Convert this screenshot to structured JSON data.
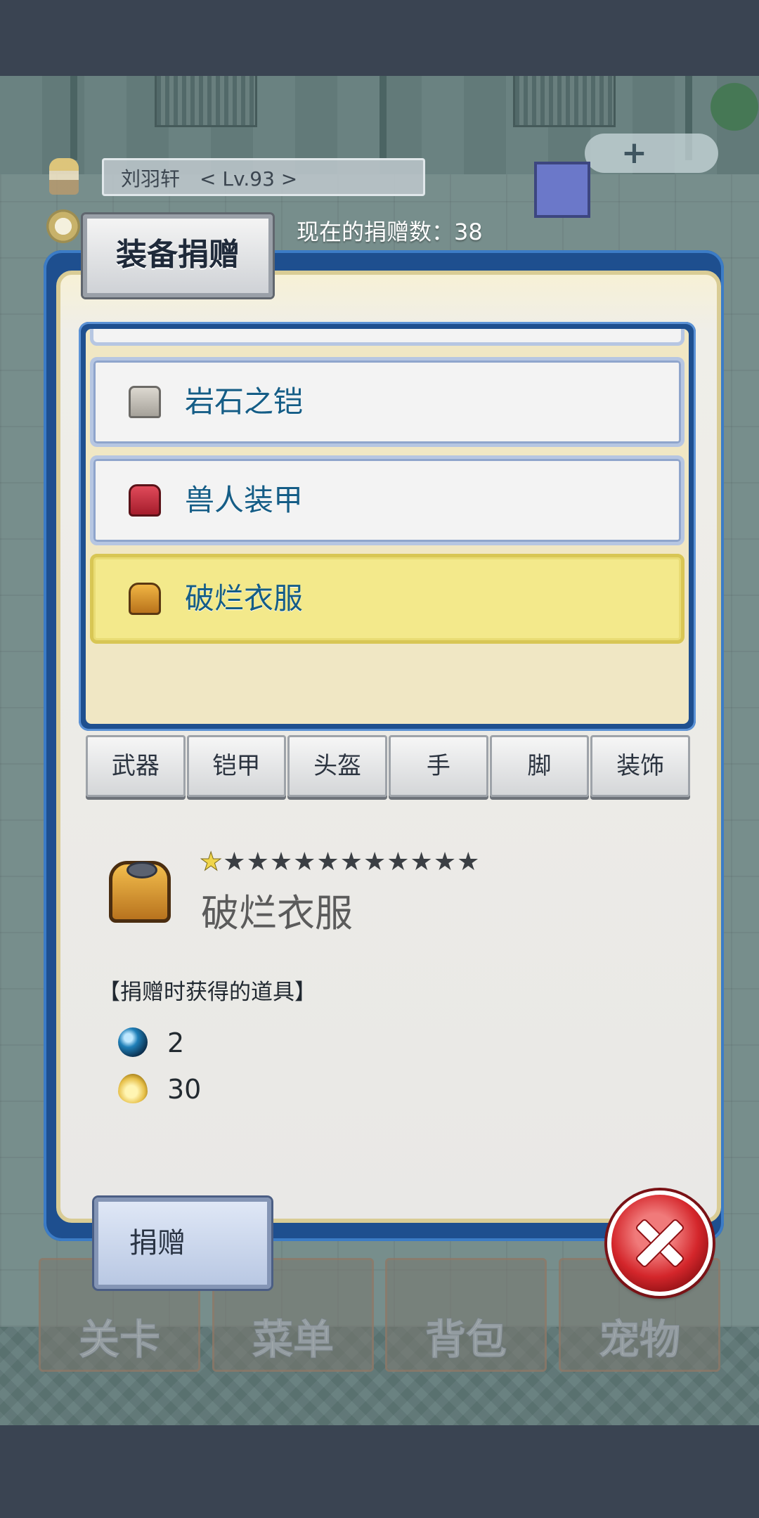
{
  "hud": {
    "player_name": "刘羽轩　< Lv.93 >",
    "donate_count": "现在的捐赠数：38"
  },
  "panel": {
    "title": "装备捐赠"
  },
  "equipment_list": [
    {
      "label": "岩石之铠",
      "icon": "rock-armor-icon",
      "selected": false
    },
    {
      "label": "兽人装甲",
      "icon": "orc-armor-icon",
      "selected": false
    },
    {
      "label": "破烂衣服",
      "icon": "ragged-clothes-icon",
      "selected": true
    }
  ],
  "tabs": [
    "武器",
    "铠甲",
    "头盔",
    "手",
    "脚",
    "装饰"
  ],
  "detail": {
    "name": "破烂衣服",
    "rarity_stars": 1,
    "max_stars": 12,
    "reward_heading": "【捐赠时获得的道具】",
    "rewards": [
      {
        "icon": "blue-orb-icon",
        "value": "2"
      },
      {
        "icon": "gold-drop-icon",
        "value": "30"
      }
    ]
  },
  "buttons": {
    "donate": "捐赠"
  },
  "background_nav": [
    "关卡",
    "菜单",
    "背包",
    "宠物"
  ],
  "colors": {
    "panel_border": "#1e4f8f",
    "selected_row": "#f3e98b",
    "list_label": "#155d86",
    "close_red": "#d4262b"
  }
}
